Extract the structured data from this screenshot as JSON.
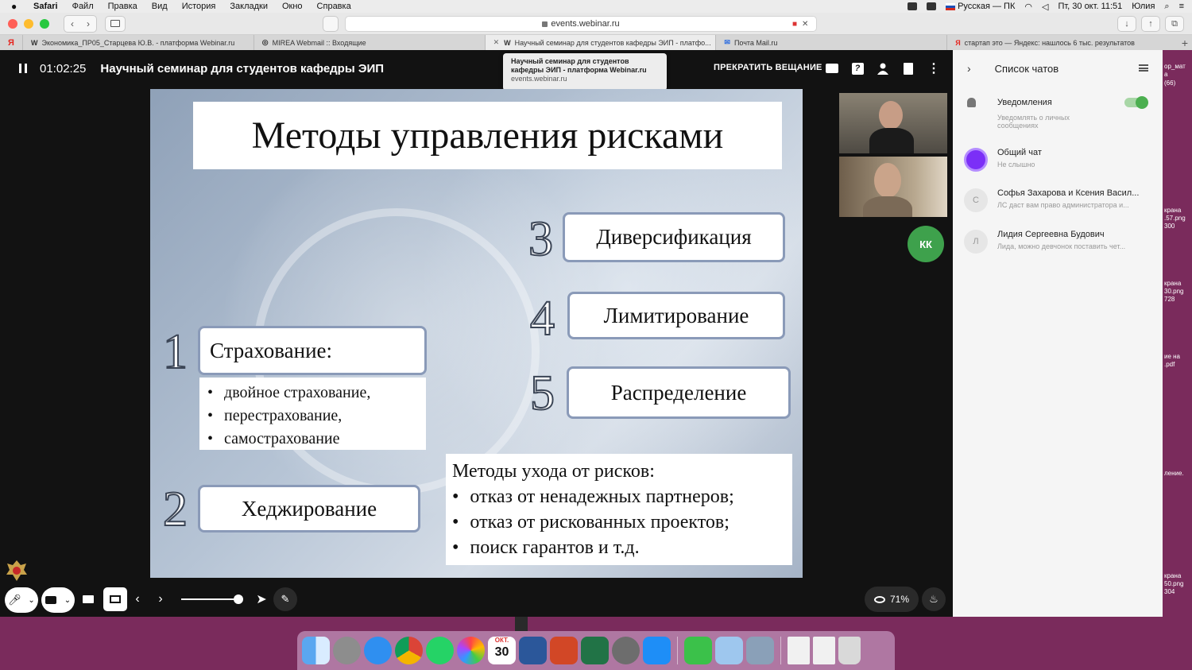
{
  "menubar": {
    "app": "Safari",
    "items": [
      "Файл",
      "Правка",
      "Вид",
      "История",
      "Закладки",
      "Окно",
      "Справка"
    ],
    "input_source": "Русская — ПК",
    "datetime": "Пт, 30 окт.  11:51",
    "user": "Юлия"
  },
  "browser": {
    "url": "events.webinar.ru",
    "tabs": [
      {
        "favicon": "W",
        "label": "Экономика_ПР05_Старцева Ю.В. - платформа Webinar.ru",
        "active": false
      },
      {
        "favicon": "◎",
        "label": "MIREA Webmail :: Входящие",
        "active": false
      },
      {
        "favicon": "W",
        "label": "Научный семинар для студентов кафедры ЭИП - платфо...",
        "active": true
      },
      {
        "favicon": "✉",
        "label": "Почта Mail.ru",
        "active": false
      },
      {
        "favicon": "Я",
        "label": "стартап это — Яндекс: нашлось 6 тыс. результатов",
        "active": false
      }
    ],
    "yandex_tab": "Я"
  },
  "webinar": {
    "timer": "01:02:25",
    "title": "Научный семинар для студентов кафедры ЭИП",
    "stop_label": "ПРЕКРАТИТЬ ВЕЩАНИЕ",
    "help_glyph": "?",
    "more_glyph": "⋮",
    "tooltip": {
      "line1": "Научный семинар для студентов",
      "line2": "кафедры ЭИП - платформа Webinar.ru",
      "host": "events.webinar.ru"
    },
    "visibility_percent": "71%",
    "participant_initials": "КК"
  },
  "slide": {
    "title": "Методы управления рисками",
    "items": [
      {
        "num": "1",
        "label": "Страхование:"
      },
      {
        "num": "2",
        "label": "Хеджирование"
      },
      {
        "num": "3",
        "label": "Диверсификация"
      },
      {
        "num": "4",
        "label": "Лимитирование"
      },
      {
        "num": "5",
        "label": "Распределение"
      }
    ],
    "insurance_list": [
      "двойное страхование,",
      "перестрахование,",
      "самострахование"
    ],
    "avoid_title": "Методы ухода от рисков:",
    "avoid_list": [
      "отказ от ненадежных партнеров;",
      "отказ от рискованных проектов;",
      "поиск гарантов и т.д."
    ]
  },
  "chat": {
    "title": "Список чатов",
    "notifications": {
      "title": "Уведомления",
      "subtitle": "Уведомлять о личных сообщениях",
      "enabled": true
    },
    "items": [
      {
        "avatar": "",
        "name": "Общий чат",
        "preview": "Не слышно",
        "color": "#7b2ff7"
      },
      {
        "avatar": "С",
        "name": "Софья Захарова и Ксения Васил...",
        "preview": "ЛС даст вам право администратора и..."
      },
      {
        "avatar": "Л",
        "name": "Лидия Сергеевна Будович",
        "preview": "Лида, можно девчонок поставить чет..."
      }
    ]
  },
  "desktop_files": [
    "ор_мат",
    "а",
    "(66)",
    "крана",
    ".57.png",
    "300",
    "крана",
    "30.png",
    "728",
    "ие на",
    ".pdf",
    "ление.",
    "крана",
    "50.png",
    "304"
  ],
  "dock": {
    "calendar_month": "ОКТ.",
    "calendar_day": "30"
  }
}
